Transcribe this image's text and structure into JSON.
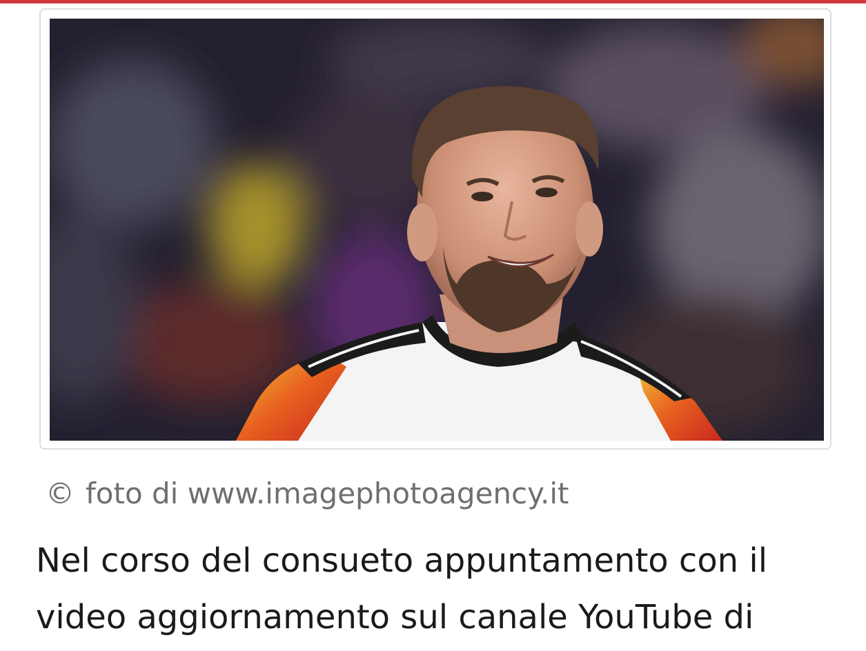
{
  "colors": {
    "accent_bar": "#d0373c",
    "caption": "#6f6f6f",
    "body_text": "#1a1a1a"
  },
  "photo": {
    "icon": "player-photo"
  },
  "caption": {
    "symbol": "©",
    "text": "foto di www.imagephotoagency.it"
  },
  "article": {
    "lines": [
      "Nel corso del consueto appuntamento con il",
      "video aggiornamento sul canale YouTube di"
    ]
  }
}
